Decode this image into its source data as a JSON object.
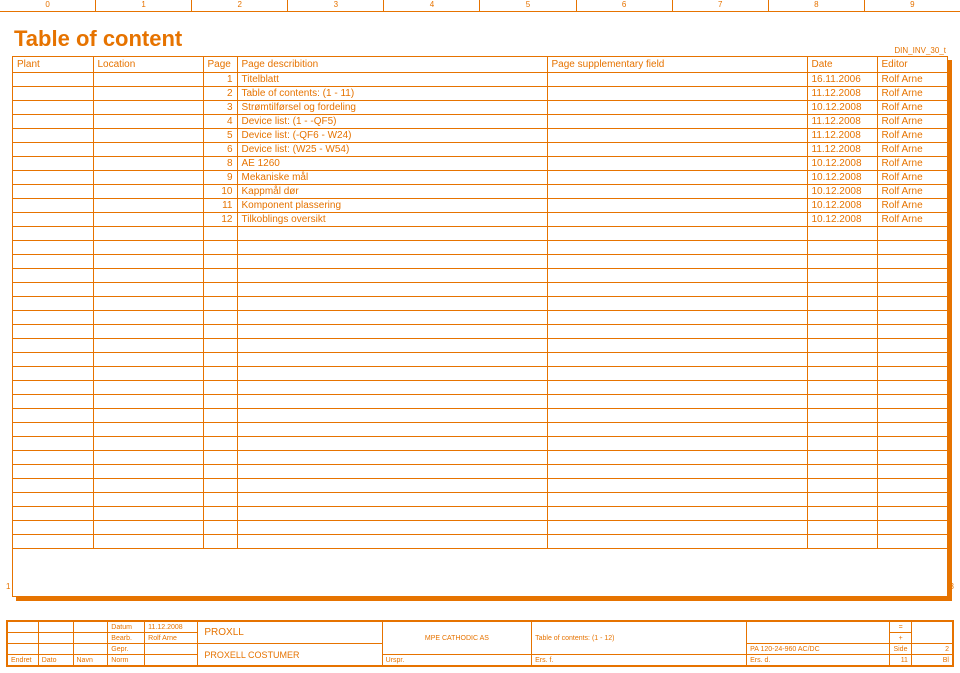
{
  "ruler": [
    "0",
    "1",
    "2",
    "3",
    "4",
    "5",
    "6",
    "7",
    "8",
    "9"
  ],
  "title": "Table of content",
  "doc_code": "DIN_INV_30_t",
  "side_left": "1",
  "side_right": "3",
  "headers": {
    "plant": "Plant",
    "location": "Location",
    "page": "Page",
    "desc": "Page describition",
    "supp": "Page supplementary field",
    "date": "Date",
    "editor": "Editor"
  },
  "rows": [
    {
      "plant": "",
      "location": "",
      "page": "1",
      "desc": "Titelblatt",
      "supp": "",
      "date": "16.11.2006",
      "editor": "Rolf Arne"
    },
    {
      "plant": "",
      "location": "",
      "page": "2",
      "desc": "Table of contents:  (1 - 11)",
      "supp": "",
      "date": "11.12.2008",
      "editor": "Rolf Arne"
    },
    {
      "plant": "",
      "location": "",
      "page": "3",
      "desc": "Strømtilførsel og fordeling",
      "supp": "",
      "date": "10.12.2008",
      "editor": "Rolf Arne"
    },
    {
      "plant": "",
      "location": "",
      "page": "4",
      "desc": "Device list:  (1 - -QF5)",
      "supp": "",
      "date": "11.12.2008",
      "editor": "Rolf Arne"
    },
    {
      "plant": "",
      "location": "",
      "page": "5",
      "desc": "Device list:  (-QF6 - W24)",
      "supp": "",
      "date": "11.12.2008",
      "editor": "Rolf Arne"
    },
    {
      "plant": "",
      "location": "",
      "page": "6",
      "desc": "Device list:  (W25 - W54)",
      "supp": "",
      "date": "11.12.2008",
      "editor": "Rolf Arne"
    },
    {
      "plant": "",
      "location": "",
      "page": "8",
      "desc": "AE 1260",
      "supp": "",
      "date": "10.12.2008",
      "editor": "Rolf Arne"
    },
    {
      "plant": "",
      "location": "",
      "page": "9",
      "desc": "Mekaniske mål",
      "supp": "",
      "date": "10.12.2008",
      "editor": "Rolf Arne"
    },
    {
      "plant": "",
      "location": "",
      "page": "10",
      "desc": "Kappmål dør",
      "supp": "",
      "date": "10.12.2008",
      "editor": "Rolf Arne"
    },
    {
      "plant": "",
      "location": "",
      "page": "11",
      "desc": "Komponent plassering",
      "supp": "",
      "date": "10.12.2008",
      "editor": "Rolf Arne"
    },
    {
      "plant": "",
      "location": "",
      "page": "12",
      "desc": "Tilkoblings oversikt",
      "supp": "",
      "date": "10.12.2008",
      "editor": "Rolf Arne"
    }
  ],
  "empty_rows": 23,
  "tb": {
    "datum_l": "Datum",
    "datum_v": "11.12.2008",
    "bearb_l": "Bearb.",
    "bearb_v": "Rolf Arne",
    "gepr_l": "Gepr.",
    "company": "PROXLL",
    "company2": "PROXELL COSTUMER",
    "middle": "MPE CATHODIC AS",
    "toc": "Table of contents:  (1 - 12)",
    "proj": "PA 120-24-960 AC/DC",
    "eq": "=",
    "plus": "+",
    "side_l": "Side",
    "side_v": "2",
    "endret": "Endret",
    "dato": "Dato",
    "navn": "Navn",
    "norm": "Norm",
    "urspr": "Urspr.",
    "ersf": "Ers. f.",
    "ersd": "Ers. d.",
    "bl_n": "11",
    "bl": "Bl"
  }
}
